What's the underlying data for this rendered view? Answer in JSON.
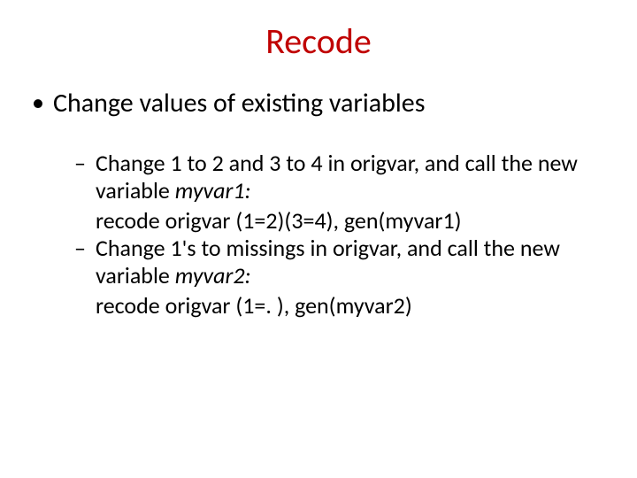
{
  "title": "Recode",
  "bullet1": "Change values of existing variables",
  "sub1_a": "Change 1 to 2 and 3 to 4 in origvar, and call the new variable ",
  "sub1_b": "myvar1:",
  "code1": "recode origvar (1=2)(3=4), gen(myvar1)",
  "sub2_a": "Change 1's to missings in origvar, and call the new variable ",
  "sub2_b": "myvar2:",
  "code2": "recode origvar (1=. ), gen(myvar2)"
}
